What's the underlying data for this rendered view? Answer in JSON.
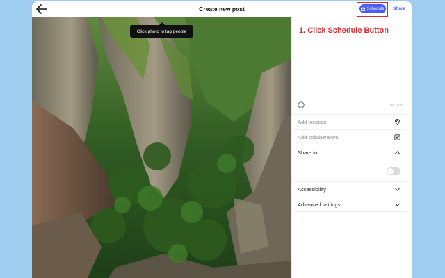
{
  "header": {
    "title": "Create new post",
    "schedule_label": "Schedule",
    "share_label": "Share"
  },
  "photo": {
    "tooltip": "Click photo to tag people"
  },
  "panel": {
    "annotation": "1. Click Schedule Button",
    "char_count": "0/2,200",
    "add_location": "Add location",
    "add_collaborators": "Add collaborators",
    "share_to": "Share to",
    "share_to_toggle_label": "",
    "accessibility": "Accessibility",
    "advanced_settings": "Advanced settings"
  },
  "colors": {
    "accent": "#4a5df6",
    "annotation": "#e0282e",
    "background": "#9fcdf0"
  },
  "icons": [
    "arrow-left-icon",
    "calendar-icon",
    "emoji-icon",
    "location-pin-icon",
    "add-person-icon",
    "chevron-up-icon",
    "chevron-down-icon"
  ]
}
